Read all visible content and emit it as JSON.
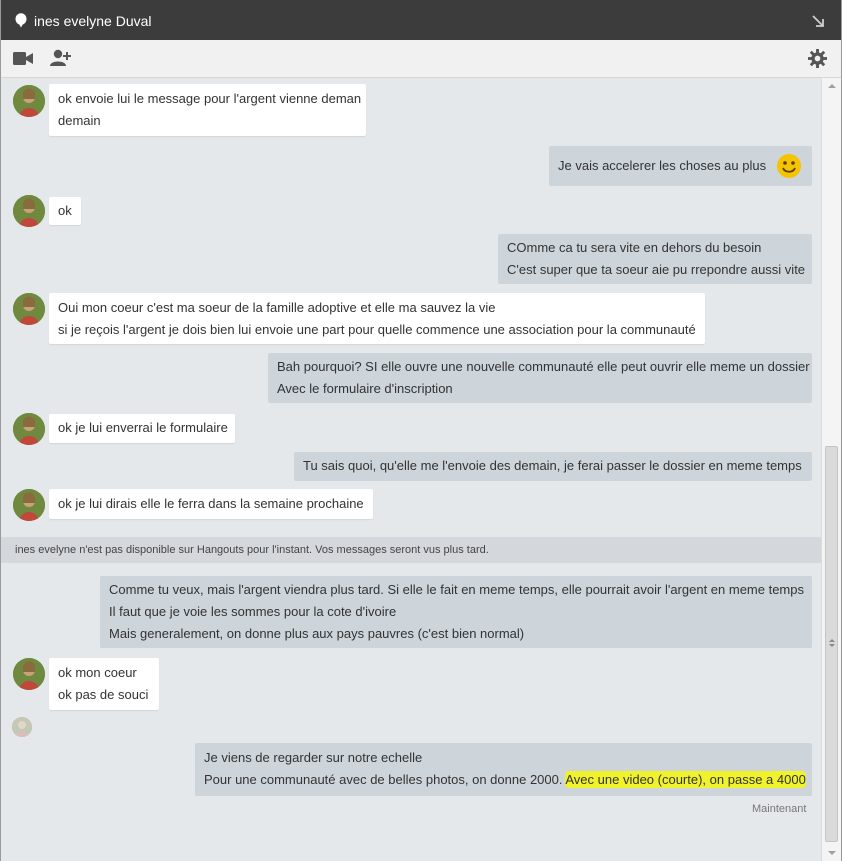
{
  "window": {
    "title": "ines evelyne Duval",
    "icons": {
      "pin": "pin-icon",
      "popout": "popout-arrow-icon"
    }
  },
  "toolbar": {
    "icons": [
      "video-call-icon",
      "add-person-icon",
      "settings-gear-icon"
    ]
  },
  "messages": [
    {
      "from": "contact",
      "lines": [
        "ok envoie lui le message pour l'argent vienne deman",
        "demain"
      ]
    },
    {
      "from": "me",
      "lines": [
        "Je vais accelerer les choses au plus"
      ],
      "emoji": "smiley-icon"
    },
    {
      "from": "contact",
      "lines": [
        "ok"
      ]
    },
    {
      "from": "me",
      "lines": [
        "COmme ca tu sera vite en dehors du besoin",
        "C'est super que ta soeur aie pu rrepondre aussi vite"
      ]
    },
    {
      "from": "contact",
      "lines": [
        "Oui mon coeur c'est ma soeur de la famille adoptive et elle ma sauvez la vie",
        "si je reçois l'argent je dois bien lui envoie une part pour quelle commence une association pour la communauté"
      ]
    },
    {
      "from": "me",
      "lines": [
        "Bah pourquoi? SI elle ouvre une nouvelle communauté elle peut ouvrir elle meme un dossier",
        "Avec le formulaire d'inscription"
      ]
    },
    {
      "from": "contact",
      "lines": [
        "ok je lui enverrai le formulaire"
      ]
    },
    {
      "from": "me",
      "lines": [
        "Tu sais quoi, qu'elle me l'envoie des demain, je ferai passer le dossier en meme temps"
      ]
    },
    {
      "from": "contact",
      "lines": [
        "ok je lui dirais elle le ferra dans la semaine prochaine"
      ]
    },
    {
      "from": "me",
      "lines": [
        "Comme tu veux, mais l'argent viendra plus tard. Si elle le fait en meme temps, elle pourrait avoir l'argent en meme temps",
        "Il faut que je voie les sommes pour la cote d'ivoire",
        "Mais generalement, on donne plus aux pays pauvres (c'est bien normal)"
      ]
    },
    {
      "from": "contact",
      "lines": [
        "ok mon coeur",
        "ok pas de souci"
      ]
    },
    {
      "from": "me",
      "lines": [
        "Je viens de regarder sur notre echelle",
        "Pour une communauté avec de belles photos, on donne 2000. "
      ],
      "highlighted": "Avec une video (courte), on passe a 4000"
    }
  ],
  "status_notice": "ines evelyne n'est pas disponible sur Hangouts pour l'instant. Vos messages seront vus plus tard.",
  "last_timestamp": "Maintenant",
  "colors": {
    "titlebar": "#3c3c3c",
    "chat_background": "#e5e8eb",
    "incoming_bubble": "#ffffff",
    "outgoing_bubble": "#cdd4da",
    "highlight": "#f0f22c"
  }
}
